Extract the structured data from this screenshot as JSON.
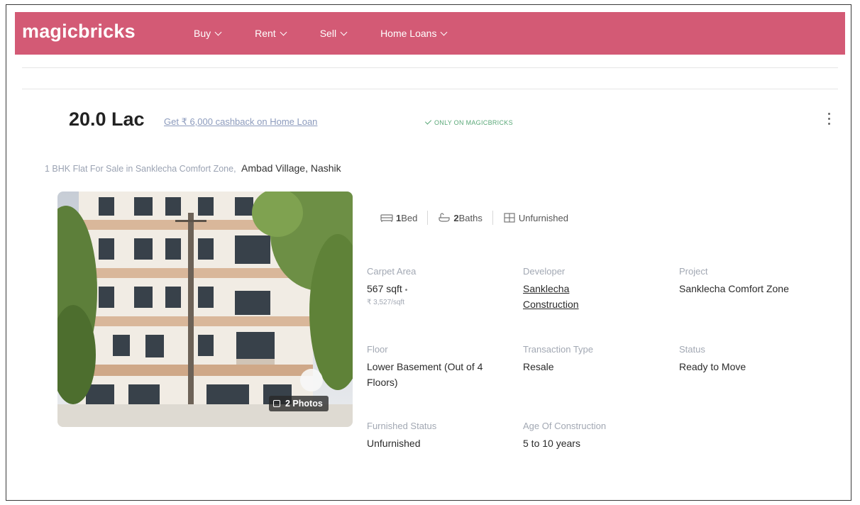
{
  "nav": {
    "logo": "magicbricks",
    "items": [
      {
        "label": "Buy"
      },
      {
        "label": "Rent"
      },
      {
        "label": "Sell"
      },
      {
        "label": "Home Loans"
      }
    ]
  },
  "listing": {
    "price": "20.0 Lac",
    "cashback": "Get ₹ 6,000 cashback on Home Loan",
    "badge": "ONLY ON MAGICBRICKS",
    "subtitle": "1 BHK Flat For Sale in Sanklecha Comfort Zone,",
    "location": "Ambad Village, Nashik",
    "photo_count": "2 Photos",
    "amenities": {
      "beds_num": "1",
      "beds_label": "Bed",
      "baths_num": "2",
      "baths_label": "Baths",
      "furnishing": "Unfurnished"
    },
    "specs": {
      "carpet_area": {
        "label": "Carpet Area",
        "value": "567 sqft",
        "sub": "₹ 3,527/sqft"
      },
      "developer": {
        "label": "Developer",
        "value": "Sanklecha Construction"
      },
      "project": {
        "label": "Project",
        "value": "Sanklecha Comfort Zone"
      },
      "floor": {
        "label": "Floor",
        "value": "Lower Basement (Out of 4 Floors)"
      },
      "transaction": {
        "label": "Transaction Type",
        "value": "Resale"
      },
      "status": {
        "label": "Status",
        "value": "Ready to Move"
      },
      "furnished": {
        "label": "Furnished Status",
        "value": "Unfurnished"
      },
      "age": {
        "label": "Age Of Construction",
        "value": "5 to 10 years"
      }
    }
  },
  "colors": {
    "brand": "#d35a75",
    "badge_green": "#5aa878",
    "link_blue": "#8c9bbd"
  }
}
